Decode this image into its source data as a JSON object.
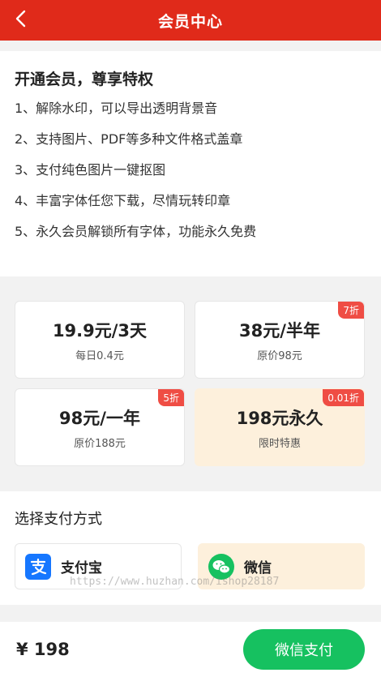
{
  "header": {
    "title": "会员中心",
    "back_icon": "chevron-left-icon"
  },
  "benefits": {
    "heading": "开通会员，尊享特权",
    "items": [
      "1、解除水印，可以导出透明背景音",
      "2、支持图片、PDF等多种文件格式盖章",
      "3、支付纯色图片一键抠图",
      "4、丰富字体任您下载，尽情玩转印章",
      "5、永久会员解锁所有字体，功能永久免费"
    ]
  },
  "plans": [
    {
      "price": "19.9元/3天",
      "sub": "每日0.4元",
      "badge": ""
    },
    {
      "price": "38元/半年",
      "sub": "原价98元",
      "badge": "7折"
    },
    {
      "price": "98元/一年",
      "sub": "原价188元",
      "badge": "5折"
    },
    {
      "price": "198元永久",
      "sub": "限时特惠",
      "badge": "0.01折",
      "selected": true
    }
  ],
  "payment": {
    "heading": "选择支付方式",
    "options": [
      {
        "label": "支付宝",
        "icon": "alipay-icon",
        "color": "#1677ff"
      },
      {
        "label": "微信",
        "icon": "wechat-icon",
        "color": "#16c160",
        "selected": true
      }
    ]
  },
  "watermark": "https://www.huzhan.com/ishop28187",
  "footer": {
    "total": "¥ 198",
    "pay_label": "微信支付"
  },
  "colors": {
    "header": "#e02a1a",
    "badge": "#ef4d44",
    "selected_bg": "#fdf0dc",
    "pay_button": "#16c160"
  }
}
